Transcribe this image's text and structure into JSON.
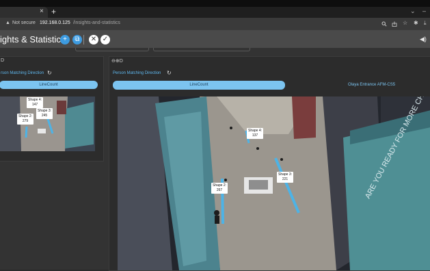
{
  "browser": {
    "tab_close": "×",
    "new_tab": "+",
    "win_min": "⌄",
    "win_close": "–",
    "warning_icon": "▲",
    "security_text": "Not secure",
    "host": "192.168.0.125",
    "path": "/insights-and-statistics",
    "icons": [
      "search-icon",
      "share-icon",
      "star-icon",
      "extensions-icon",
      "download-icon"
    ]
  },
  "header": {
    "title": "ights & Statistics",
    "add_glyph": "+",
    "copy_glyph": "⧉",
    "cancel_glyph": "✕",
    "confirm_glyph": "✓",
    "speaker_glyph": "◀)"
  },
  "left_panel": {
    "top_label": "D",
    "direction_label": "rson Matching Direction",
    "refresh_glyph": "↻",
    "linecount": "LineCount",
    "shapes": [
      {
        "name": "Shape 4:",
        "count": "147"
      },
      {
        "name": "Shape 3:",
        "count": "245"
      },
      {
        "name": "Shape 2:",
        "count": "279"
      }
    ]
  },
  "right_panel": {
    "top_label": "⊖⊕D",
    "direction_label": "Person Matching Direction",
    "refresh_glyph": "↻",
    "linecount": "LineCount",
    "entrance_tab": "Olaya Entrance AFM-CS5",
    "shapes": [
      {
        "name": "Shape 4:",
        "count": "137"
      },
      {
        "name": "Shape 3:",
        "count": "221"
      },
      {
        "name": "Shape 2:",
        "count": "267"
      }
    ],
    "signage_text": "ARE YOU READY FOR MORE CHILDREN'S FASHION?"
  },
  "colors": {
    "accent": "#3d9be0",
    "linecount_bg": "#7cc4f0",
    "label_blue": "#5fb8ef"
  }
}
